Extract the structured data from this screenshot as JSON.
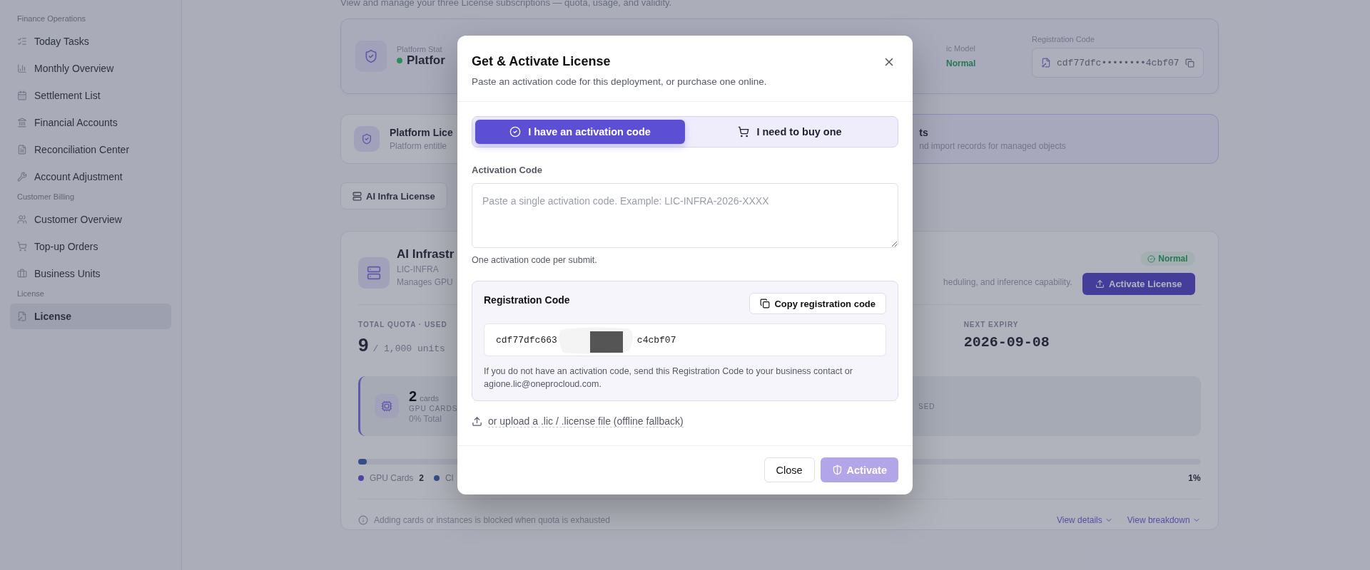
{
  "sidebar": {
    "sections": [
      {
        "title": "Finance Operations",
        "items": [
          {
            "label": "Today Tasks",
            "selected": false
          },
          {
            "label": "Monthly Overview",
            "selected": false
          },
          {
            "label": "Settlement List",
            "selected": false
          },
          {
            "label": "Financial Accounts",
            "selected": false
          },
          {
            "label": "Reconciliation Center",
            "selected": false
          },
          {
            "label": "Account Adjustment",
            "selected": false
          }
        ]
      },
      {
        "title": "Customer Billing",
        "items": [
          {
            "label": "Customer Overview",
            "selected": false
          },
          {
            "label": "Top-up Orders",
            "selected": false
          },
          {
            "label": "Business Units",
            "selected": false
          }
        ]
      },
      {
        "title": "License",
        "items": [
          {
            "label": "License",
            "selected": true
          }
        ]
      }
    ]
  },
  "page": {
    "subtitle": "View and manage your three License subscriptions — quota, usage, and validity.",
    "status_card": {
      "label": "Platform Stat",
      "value": "Platfor",
      "model_label": "ic Model",
      "model_value": "Normal",
      "registration_label": "Registration Code",
      "registration_value": "cdf77dfc••••••••4cbf07"
    },
    "info_cards": [
      {
        "title": "Platform Lice",
        "text": "Platform entitle",
        "highlighted": false
      },
      {
        "title": "ts",
        "text": "nd import records for managed objects",
        "highlighted": true
      }
    ],
    "license_tabs": [
      {
        "label": "AI Infra License",
        "selected": true
      }
    ],
    "license_card": {
      "title": "AI Infrastr",
      "code": "LIC-INFRA",
      "description": "Manages GPU",
      "description_tail": "heduling, and inference capability.",
      "status": "Normal",
      "action": "Activate License",
      "quota_label": "TOTAL QUOTA · USED",
      "quota_used": "9",
      "quota_total": "/ 1,000 units",
      "expiry_label": "NEXT EXPIRY",
      "expiry_value": "2026-09-08",
      "resource": {
        "count": "2",
        "unit": "cards",
        "label": "GPU CARDS",
        "share": "0% Total",
        "tail": "SED"
      },
      "usage": {
        "level": 0.01,
        "legend": [
          {
            "label": "GPU Cards",
            "value": "2"
          },
          {
            "label": "Cl"
          }
        ],
        "percent": "1%"
      },
      "notice": "Adding cards or instances is blocked when quota is exhausted",
      "links": [
        "View details",
        "View breakdown"
      ]
    }
  },
  "dialog": {
    "title": "Get & Activate License",
    "subtitle": "Paste an activation code for this deployment, or purchase one online.",
    "modes": [
      {
        "label": "I have an activation code",
        "selected": true
      },
      {
        "label": "I need to buy one",
        "selected": false
      }
    ],
    "code_label": "Activation Code",
    "code_placeholder": "Paste a single activation code. Example: LIC-INFRA-2026-XXXX",
    "code_hint": "One activation code per submit.",
    "registration": {
      "title": "Registration Code",
      "copy": "Copy registration code",
      "code_start": "cdf77dfc663",
      "code_end": "c4cbf07",
      "help": "If you do not have an activation code, send this Registration Code to your business contact or agione.lic@oneprocloud.com."
    },
    "upload": "or upload a .lic / .license file (offline fallback)",
    "buttons": {
      "close": "Close",
      "activate": "Activate",
      "activate_disabled": true
    }
  }
}
